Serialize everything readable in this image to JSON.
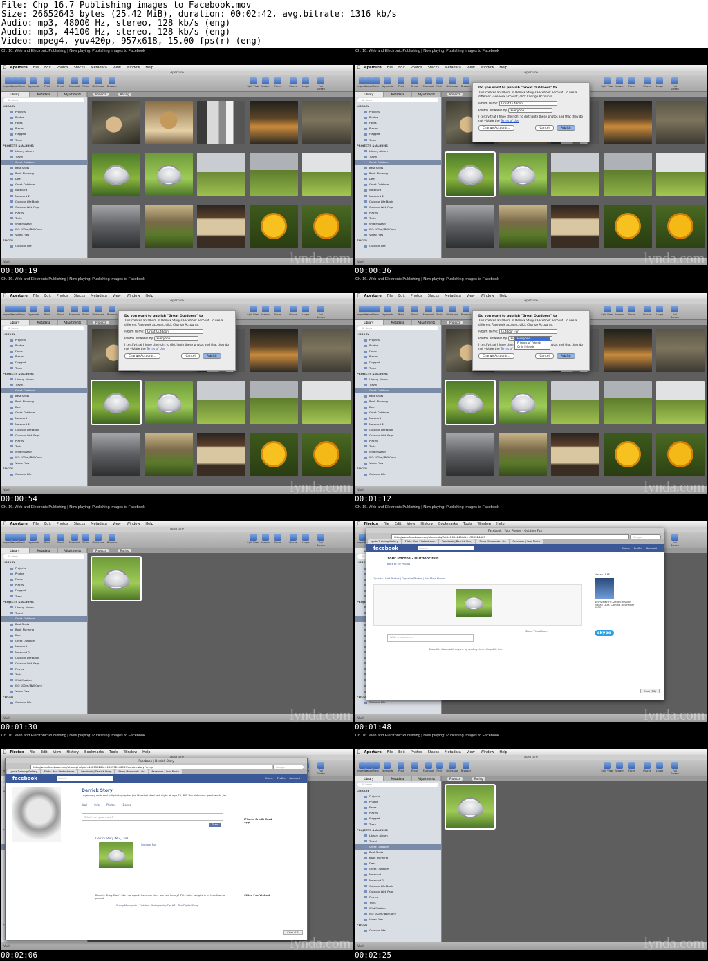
{
  "header": {
    "line1": "File: Chp 16.7 Publishing images to Facebook.mov",
    "line2": "Size: 26652643 bytes (25.42 MiB), duration: 00:02:42, avg.bitrate: 1316 kb/s",
    "line3": "Audio: mp3, 48000 Hz, stereo, 128 kb/s (eng)",
    "line4": "Audio: mp3, 44100 Hz, stereo, 128 kb/s (eng)",
    "line5": "Video: mpeg4, yuv420p, 957x618, 15.00 fps(r) (eng)"
  },
  "caption": "Ch. 16. Web and Electronic Publishing | Now playing: Publishing images to Facebook",
  "watermark": "lynda.com",
  "aperture": {
    "menu": [
      "Aperture",
      "File",
      "Edit",
      "Photos",
      "Stacks",
      "Metadata",
      "View",
      "Window",
      "Help"
    ],
    "window_title": "Aperture",
    "toolbar": [
      "Inspector",
      "Import",
      "New",
      "Keywords",
      "Print",
      "Email",
      "Facebook",
      "Flickr",
      "Slideshow",
      "Browser",
      "Split View",
      "Viewer",
      "Faces",
      "Places",
      "Loupe",
      "Full Screen"
    ],
    "tabs": [
      "Library",
      "Metadata",
      "Adjustments"
    ],
    "search_placeholder": "All Items",
    "browser_tabs": [
      "Projects",
      "Rating"
    ],
    "vault": "Vault",
    "sidebar": [
      {
        "label": "LIBRARY",
        "type": "sect"
      },
      {
        "label": "Projects"
      },
      {
        "label": "Photos"
      },
      {
        "label": "Faces"
      },
      {
        "label": "Places"
      },
      {
        "label": "Flagged"
      },
      {
        "label": "Trash"
      },
      {
        "label": "PROJECTS & ALBUMS",
        "type": "sect"
      },
      {
        "label": "Library Album"
      },
      {
        "label": "Travel"
      },
      {
        "label": "Great Outdoors",
        "type": "sel"
      },
      {
        "label": "Best Shots"
      },
      {
        "label": "Book Planning"
      },
      {
        "label": "Deer"
      },
      {
        "label": "Great Outdoors"
      },
      {
        "label": "Notecard"
      },
      {
        "label": "Notecard 2"
      },
      {
        "label": "Outdoor Life Book"
      },
      {
        "label": "Outdoor Web Page"
      },
      {
        "label": "Places"
      },
      {
        "label": "Texts"
      },
      {
        "label": "Wild Mustard"
      },
      {
        "label": "ISO 100 w/ BW Conv"
      },
      {
        "label": "Video Files"
      },
      {
        "label": "FLICKR",
        "type": "sect"
      },
      {
        "label": "Outdoor Life"
      }
    ]
  },
  "dialog": {
    "title": "Do you want to publish \"Great Outdoors\" to",
    "body": "This creates an album in Derrick Story's Facebook account. To use a different Facebook account, click Change Accounts.",
    "album_label": "Album Name:",
    "album_value_a": "Great Outdoors",
    "album_value_b": "Outdoor Fun",
    "viewable_label": "Photos Viewable By:",
    "viewable_value": "Everyone",
    "certify": "I certify that I have the right to distribute these photos and that they do not violate the",
    "terms": "Terms of Use",
    "change": "Change Accounts...",
    "cancel": "Cancel",
    "publish": "Publish",
    "options": [
      "Everyone",
      "Friends of Friends",
      "Only Friends"
    ]
  },
  "firefox": {
    "menu": [
      "Firefox",
      "File",
      "Edit",
      "View",
      "History",
      "Bookmarks",
      "Tools",
      "Window",
      "Help"
    ],
    "title1": "Facebook | Your Photos - Outdoor Fun",
    "url1": "http://www.facebook.com/album.php?aid=2054849&id=1359524465",
    "title2": "Facebook | Derrick Story",
    "url2": "http://www.facebook.com/photo.php?pid=1087552&id=1359524465#!/derrick.story?ref=p",
    "tabs": [
      "Lynda Training Gallery",
      "Flickr: Your Photostream",
      "Facebook | Derrick Story",
      "Shiny Monopods - Ou",
      "Facebook | Your Photo"
    ],
    "search": "Google",
    "fb_logo": "facebook",
    "fb_search": "Search",
    "fb_links": [
      "Home",
      "Profile",
      "Account"
    ],
    "album_title": "Your Photos - Outdoor Fun",
    "back_link": "Back to My Photos",
    "album_meta": "1 photo | Edit Photos | Organize Photos | Add More Photos",
    "comment_placeholder": "Write a comment...",
    "share_link": "Share This Album",
    "share_caption": "Share this album with anyone by sending them this public link:",
    "ad_title": "Nissan LEAF",
    "ad_text": "100% electric. Zero Emission Nissan LEAF. Coming December 2010.",
    "skype": "skype",
    "chat": "Chat (18)",
    "profile_name": "Derrick Story",
    "profile_status": "Legendary rock and roll photographer Jim Marshall died last night at age 74. RIP. You did some great work, Jim.",
    "profile_tabs": [
      "Wall",
      "Info",
      "Photos",
      "Boxes"
    ],
    "wall_prompt": "What's on your mind?",
    "share_btn": "Share",
    "post1": "Derrick Story IMG_1288",
    "post1_sub": "Outdoor Fun",
    "post2": "Derrick Story Don't like monopods because they are too heavy? This baby weighs in at less than a pound.",
    "post2_link": "String Monopods - Outdoor Photography Tip #3 - The Digital Story",
    "right_ad": "iPhone Credit Card App",
    "cities": "Cities I've Visited"
  },
  "frames": [
    {
      "time": "00:00:19",
      "variant": "grid",
      "selected": -1
    },
    {
      "time": "00:00:36",
      "variant": "dialog",
      "selected": 5
    },
    {
      "time": "00:00:54",
      "variant": "dialog",
      "selected": 5
    },
    {
      "time": "00:01:12",
      "variant": "dialog-menu",
      "selected": 5
    },
    {
      "time": "00:01:30",
      "variant": "single",
      "selected": 0
    },
    {
      "time": "00:01:48",
      "variant": "fb-album",
      "selected": -1
    },
    {
      "time": "00:02:06",
      "variant": "fb-profile",
      "selected": -1
    },
    {
      "time": "00:02:25",
      "variant": "single",
      "selected": 0
    }
  ],
  "colors": {
    "fb_blue": "#3b5998",
    "selection": "#7a8ba8",
    "link": "#1f4fd1"
  }
}
